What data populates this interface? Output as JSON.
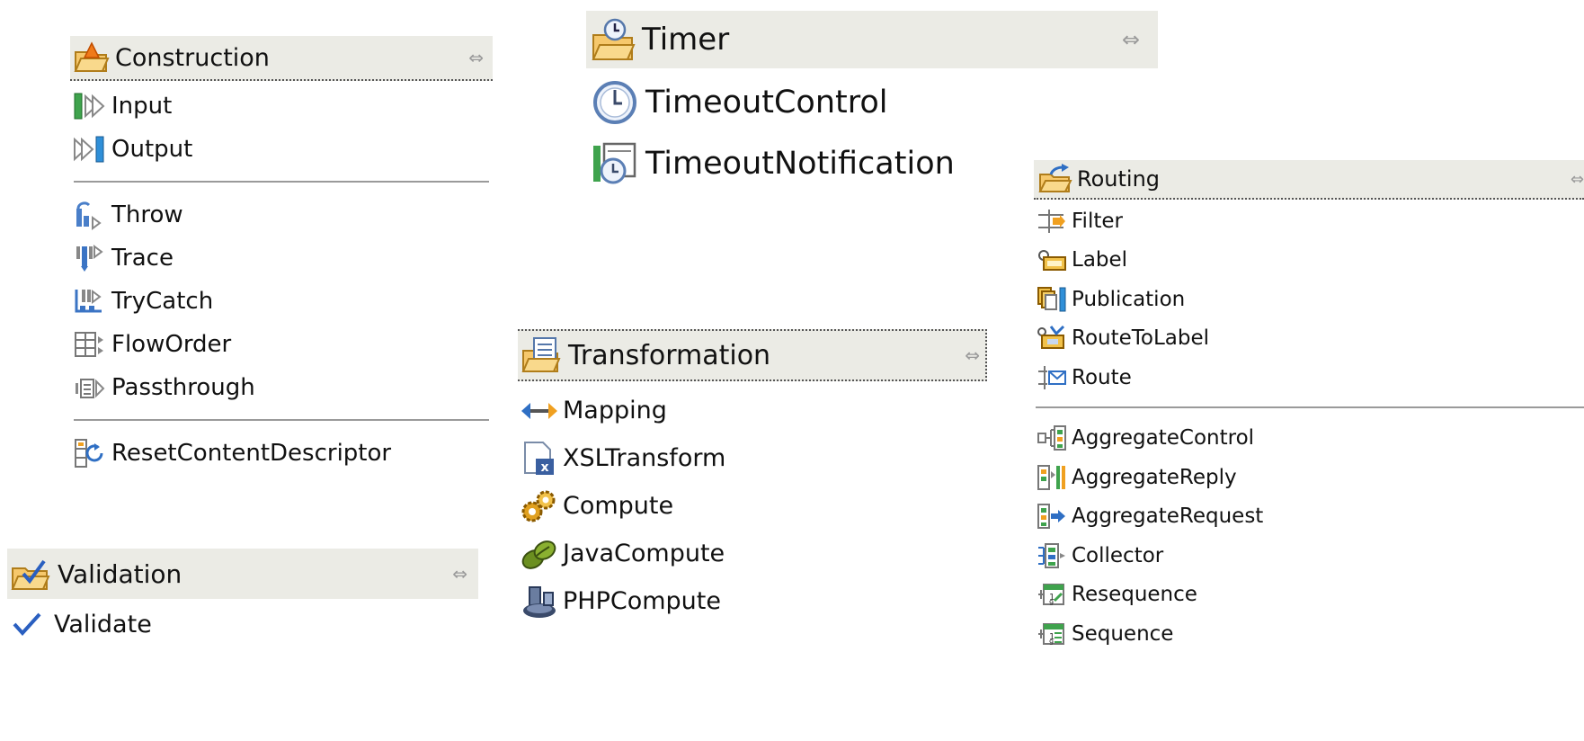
{
  "drawers": {
    "construction": {
      "title": "Construction",
      "header_icon": "folder-triangle-icon",
      "groups": [
        [
          {
            "label": "Input",
            "icon": "input-node-icon"
          },
          {
            "label": "Output",
            "icon": "output-node-icon"
          }
        ],
        [
          {
            "label": "Throw",
            "icon": "throw-node-icon"
          },
          {
            "label": "Trace",
            "icon": "trace-node-icon"
          },
          {
            "label": "TryCatch",
            "icon": "trycatch-node-icon"
          },
          {
            "label": "FlowOrder",
            "icon": "floworder-node-icon"
          },
          {
            "label": "Passthrough",
            "icon": "passthrough-node-icon"
          }
        ],
        [
          {
            "label": "ResetContentDescriptor",
            "icon": "reset-content-descriptor-icon"
          }
        ]
      ]
    },
    "validation": {
      "title": "Validation",
      "header_icon": "folder-check-icon",
      "items": [
        {
          "label": "Validate",
          "icon": "checkmark-icon"
        }
      ]
    },
    "timer": {
      "title": "Timer",
      "header_icon": "folder-clock-icon",
      "items": [
        {
          "label": "TimeoutControl",
          "icon": "clock-icon"
        },
        {
          "label": "TimeoutNotification",
          "icon": "timeout-notification-icon"
        }
      ]
    },
    "transformation": {
      "title": "Transformation",
      "header_icon": "folder-document-icon",
      "items": [
        {
          "label": "Mapping",
          "icon": "mapping-arrows-icon"
        },
        {
          "label": "XSLTransform",
          "icon": "xsl-document-icon"
        },
        {
          "label": "Compute",
          "icon": "gears-icon"
        },
        {
          "label": "JavaCompute",
          "icon": "java-beans-icon"
        },
        {
          "label": "PHPCompute",
          "icon": "php-compute-icon"
        }
      ]
    },
    "routing": {
      "title": "Routing",
      "header_icon": "folder-arrow-icon",
      "groups": [
        [
          {
            "label": "Filter",
            "icon": "filter-icon"
          },
          {
            "label": "Label",
            "icon": "label-icon"
          },
          {
            "label": "Publication",
            "icon": "publication-icon"
          },
          {
            "label": "RouteToLabel",
            "icon": "route-to-label-icon"
          },
          {
            "label": "Route",
            "icon": "route-icon"
          }
        ],
        [
          {
            "label": "AggregateControl",
            "icon": "aggregate-control-icon"
          },
          {
            "label": "AggregateReply",
            "icon": "aggregate-reply-icon"
          },
          {
            "label": "AggregateRequest",
            "icon": "aggregate-request-icon"
          },
          {
            "label": "Collector",
            "icon": "collector-icon"
          },
          {
            "label": "Resequence",
            "icon": "resequence-icon"
          },
          {
            "label": "Sequence",
            "icon": "sequence-icon"
          }
        ]
      ]
    }
  },
  "collapse_toggle_glyph": "⇔"
}
